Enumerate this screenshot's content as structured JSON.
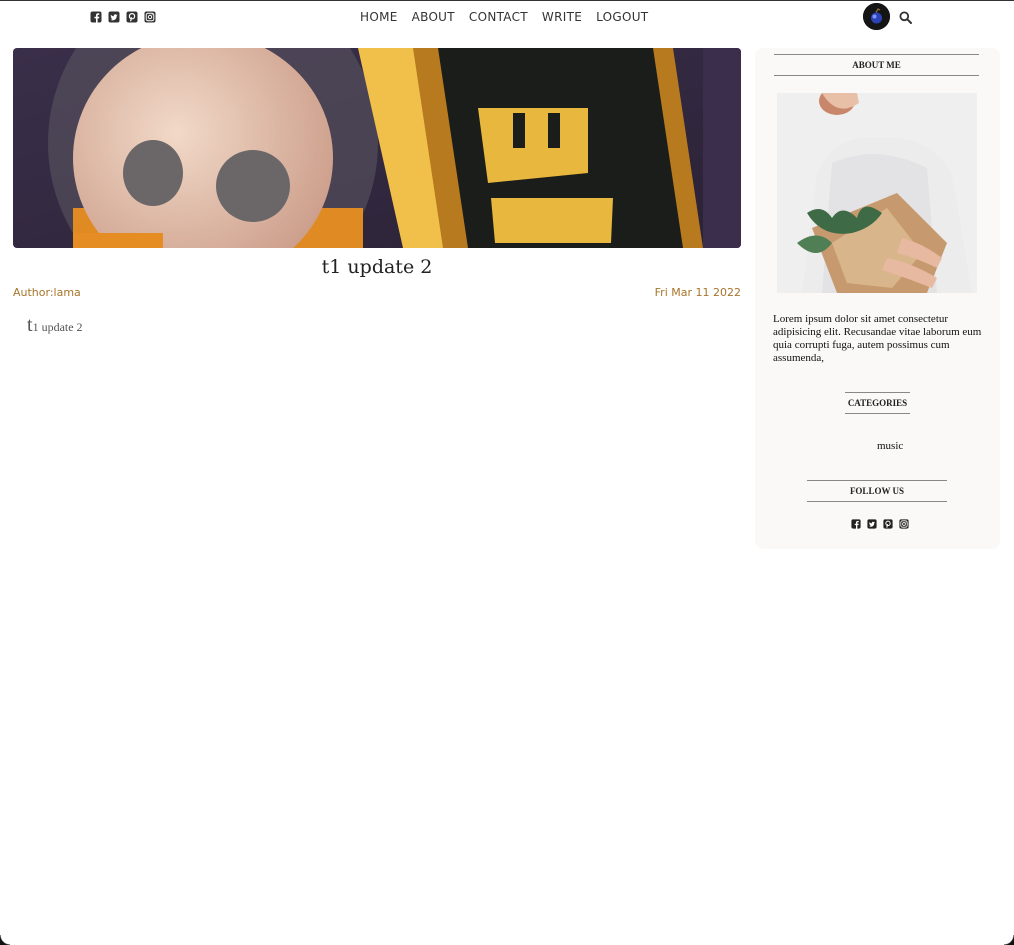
{
  "topbar": {
    "social_icons": [
      "facebook-icon",
      "twitter-icon",
      "pinterest-icon",
      "instagram-icon"
    ],
    "nav": [
      "HOME",
      "ABOUT",
      "CONTACT",
      "WRITE",
      "LOGOUT"
    ],
    "search_icon": "search-icon"
  },
  "post": {
    "title": "t1 update 2",
    "author_label": "Author:",
    "author": "lama",
    "date": "Fri Mar 11 2022",
    "body_dropcap": "t",
    "body_rest": "1 update 2"
  },
  "sidebar": {
    "about_title": "ABOUT ME",
    "about_text": "Lorem ipsum dolor sit amet consectetur adipisicing elit. Recusandae vitae laborum eum quia corrupti fuga, autem possimus cum assumenda,",
    "categories_title": "CATEGORIES",
    "categories": [
      "music"
    ],
    "follow_title": "FOLLOW US",
    "social_icons": [
      "facebook-icon",
      "twitter-icon",
      "pinterest-icon",
      "instagram-icon"
    ]
  },
  "colors": {
    "meta": "#a8752a",
    "sidebar_bg": "#fbf9f7"
  }
}
